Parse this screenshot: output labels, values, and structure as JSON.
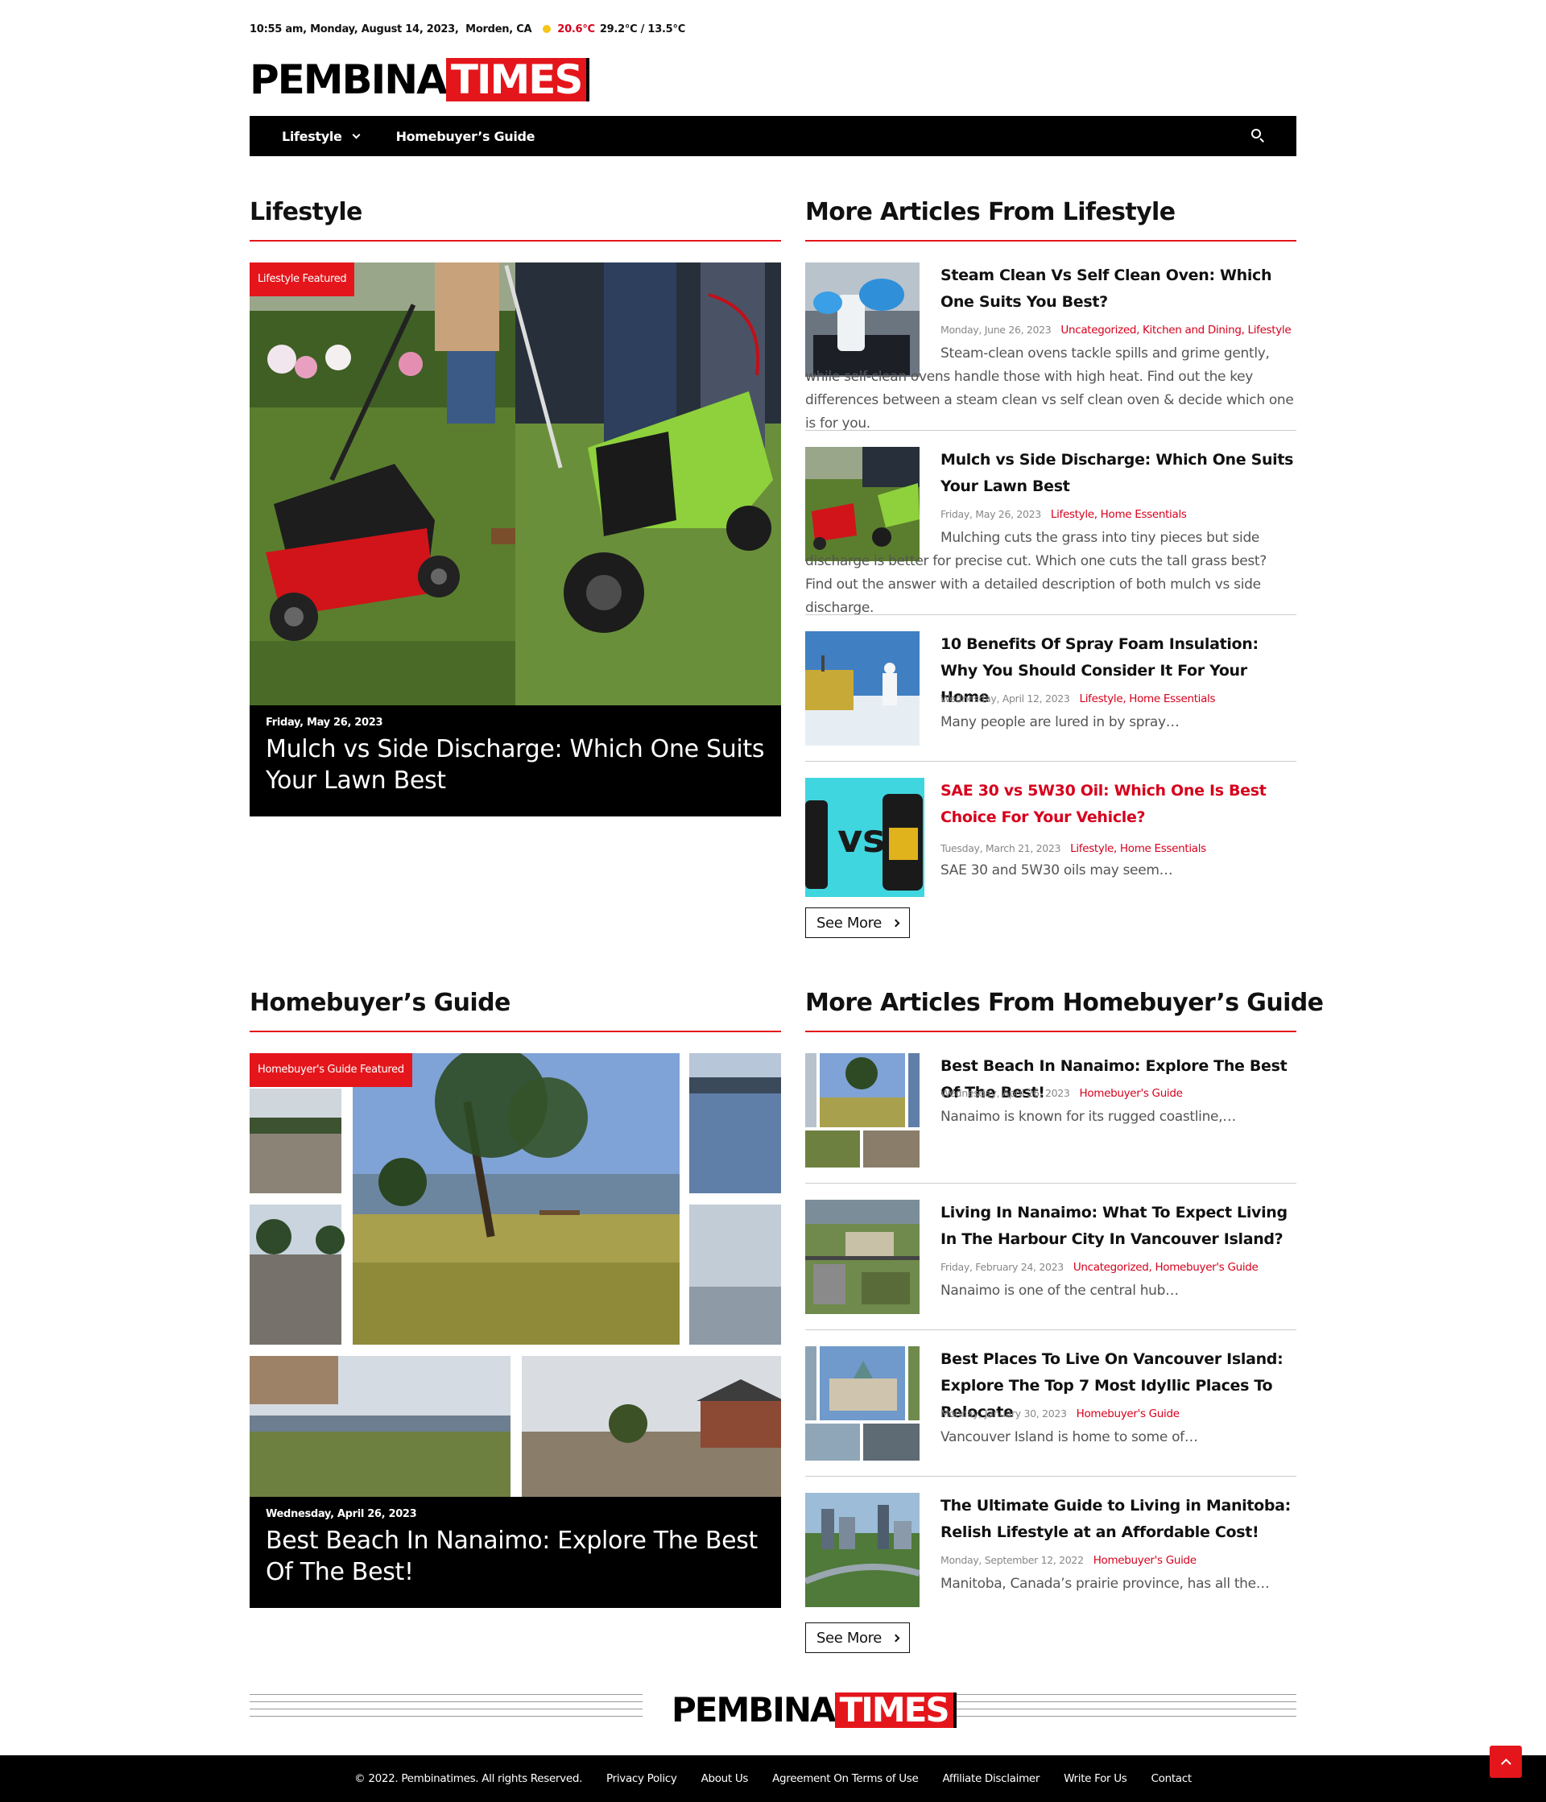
{
  "topbar": {
    "datetime": "10:55 am, Monday, August 14, 2023,",
    "location": "Morden,  CA",
    "weather_icon": "sun-icon",
    "temp_now": "20.6°C",
    "temp_range": "29.2°C / 13.5°C"
  },
  "brand": {
    "part1": "PEMBINA",
    "part2": "TIMES",
    "accent": "#e4161b"
  },
  "nav": {
    "items": [
      {
        "label": "Lifestyle",
        "has_dropdown": true
      },
      {
        "label": "Homebuyer’s Guide",
        "has_dropdown": false
      }
    ],
    "search_icon": "search-icon"
  },
  "lifestyle": {
    "title": "Lifestyle",
    "featured": {
      "badge": "Lifestyle Featured",
      "date": "Friday, May 26, 2023",
      "title": "Mulch vs Side Discharge: Which One Suits Your Lawn Best"
    },
    "more_title": "More Articles From Lifestyle",
    "articles": [
      {
        "title": "Steam Clean Vs Self Clean Oven: Which One Suits You Best?",
        "date": "Monday, June 26, 2023",
        "cats": "Uncategorized, Kitchen and Dining, Lifestyle",
        "excerpt": "Steam-clean ovens tackle spills and grime gently, while self-clean ovens handle those with high heat. Find out the key differences between a steam clean vs self clean oven & decide which one is for you."
      },
      {
        "title": "Mulch vs Side Discharge: Which One Suits Your Lawn Best",
        "date": "Friday, May 26, 2023",
        "cats": "Lifestyle, Home Essentials",
        "excerpt": "Mulching cuts the grass into tiny pieces but side discharge is better for precise cut. Which one cuts the tall grass best? Find out the answer with a detailed description of both mulch vs side discharge."
      },
      {
        "title": "10 Benefits Of Spray Foam Insulation: Why You Should Consider It For Your Home",
        "date": "Wednesday, April 12, 2023",
        "cats": "Lifestyle, Home Essentials",
        "excerpt": "Many people are lured in by spray…"
      },
      {
        "title": "SAE 30 vs 5W30 Oil: Which One Is Best Choice For Your Vehicle?",
        "date": "Tuesday, March 21, 2023",
        "cats": "Lifestyle, Home Essentials",
        "excerpt": "SAE 30 and 5W30 oils may seem…",
        "thumb_text": "vs"
      }
    ],
    "see_more": "See More"
  },
  "homebuyer": {
    "title": "Homebuyer’s Guide",
    "featured": {
      "badge": "Homebuyer's Guide Featured",
      "date": "Wednesday, April 26, 2023",
      "title": "Best Beach In Nanaimo: Explore The Best Of The Best!"
    },
    "more_title": "More Articles From Homebuyer’s Guide",
    "articles": [
      {
        "title": "Best Beach In Nanaimo: Explore The Best Of The Best!",
        "date": "Wednesday, April 26, 2023",
        "cats": "Homebuyer's Guide",
        "excerpt": "Nanaimo is known for its rugged coastline,…"
      },
      {
        "title": "Living In Nanaimo: What To Expect Living In The Harbour City In Vancouver Island?",
        "date": "Friday, February 24, 2023",
        "cats": "Uncategorized, Homebuyer's Guide",
        "excerpt": "Nanaimo is one of the central hub…"
      },
      {
        "title": "Best Places To Live On Vancouver Island: Explore The Top 7 Most Idyllic Places To Relocate",
        "date": "Monday, January 30, 2023",
        "cats": "Homebuyer's Guide",
        "excerpt": "Vancouver Island is home to some of…"
      },
      {
        "title": "The Ultimate Guide to Living in Manitoba: Relish Lifestyle at an Affordable Cost!",
        "date": "Monday, September 12, 2022",
        "cats": "Homebuyer's Guide",
        "excerpt": "Manitoba, Canada’s prairie province, has all the…"
      }
    ],
    "see_more": "See More"
  },
  "footer": {
    "copyright": "© 2022. Pembinatimes. All rights Reserved.",
    "links": [
      "Privacy Policy",
      "About Us",
      "Agreement On Terms of Use",
      "Affiliate Disclaimer",
      "Write For Us",
      "Contact"
    ],
    "back_to_top_icon": "chevron-up-icon"
  }
}
